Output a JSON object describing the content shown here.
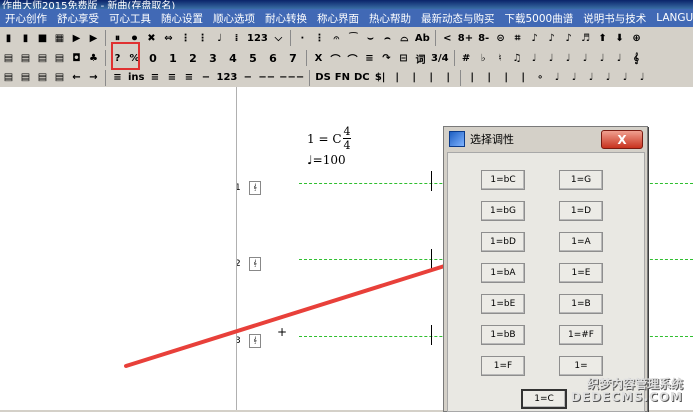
{
  "window": {
    "title": "作曲大师2015免费版 - 新曲(存盘取名)"
  },
  "menu": [
    "开心创作",
    "舒心享受",
    "可心工具",
    "随心设置",
    "顺心选项",
    "耐心转换",
    "称心界面",
    "热心帮助",
    "最新动态与购买",
    "下载5000曲谱",
    "说明书与技术",
    "LANGUAGE"
  ],
  "toolbar1": [
    "▮",
    "▮",
    "■",
    "▦",
    "▶",
    "▶",
    "⏸",
    "⏺",
    "✖",
    "⇔",
    "⋮",
    "⋮",
    "♩",
    "⁞",
    "123",
    "⌵",
    "·",
    "⋮",
    "𝄐",
    "⁀",
    "⌣",
    "⌢",
    "⌓",
    "Ab",
    "<",
    "8+",
    "8-",
    "⊝",
    "⌗",
    "♪",
    "♪",
    "♪",
    "♬",
    "⬆",
    "⬇",
    "⊕"
  ],
  "toolbar2": [
    "▤",
    "▤",
    "▤",
    "▤",
    "◘",
    "♣",
    "?",
    "%",
    "0",
    "1",
    "2",
    "3",
    "4",
    "5",
    "6",
    "7",
    "X",
    "⌒",
    "⌒",
    "≡",
    "↷",
    "⊟",
    "词",
    "3/4",
    "#",
    "♭",
    "♮",
    "♫",
    "♩",
    "♩",
    "♩",
    "♩",
    "♩",
    "♩",
    "𝄞"
  ],
  "toolbar3": [
    "▤",
    "▤",
    "▤",
    "▤",
    "←",
    "→",
    "≡",
    "ins",
    "≡",
    "≡",
    "≡",
    "−",
    "123",
    "−",
    "−−",
    "−−−",
    "DS",
    "FN",
    "DC",
    "$|",
    "|",
    "|",
    "|",
    "|",
    "|",
    "|",
    "|",
    "|",
    "∘",
    "♩",
    "♩",
    "♩",
    "♩",
    "♩",
    "♩"
  ],
  "score": {
    "key": "1 = C",
    "time_top": "4",
    "time_bottom": "4",
    "tempo": "=100",
    "staff_numbers": [
      "1",
      "2",
      "3"
    ]
  },
  "dialog": {
    "title": "选择调性",
    "close_label": "X",
    "keys_left": [
      "1=bC",
      "1=bG",
      "1=bD",
      "1=bA",
      "1=bE",
      "1=bB",
      "1=F"
    ],
    "keys_right": [
      "1=G",
      "1=D",
      "1=A",
      "1=E",
      "1=B",
      "1=#F",
      "1="
    ],
    "key_bottom": "1=C"
  },
  "watermark": {
    "line1": "织梦内容管理系统",
    "line2": "DEDECMS.COM"
  },
  "colors": {
    "menubar": "#4169b5",
    "highlight": "#e03131",
    "staff_line": "#2fbf2f"
  }
}
